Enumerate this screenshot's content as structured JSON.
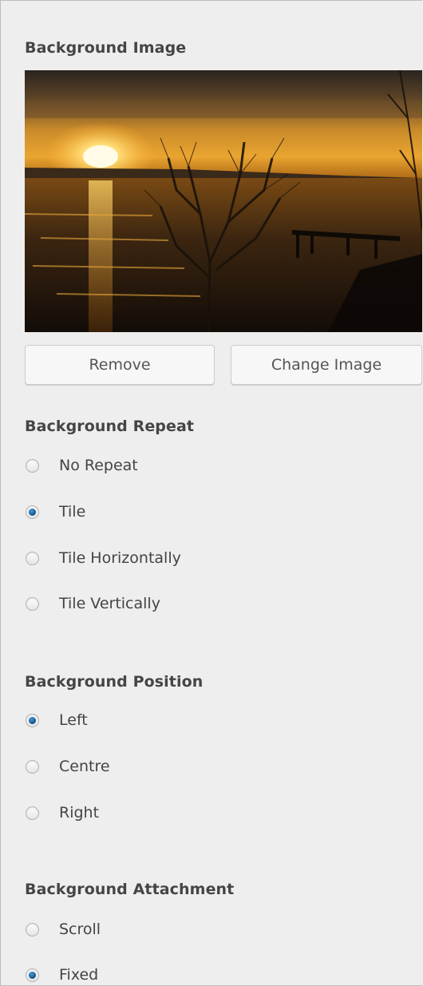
{
  "background_image": {
    "title": "Background Image",
    "remove_label": "Remove",
    "change_label": "Change Image"
  },
  "background_repeat": {
    "title": "Background Repeat",
    "options": [
      {
        "label": "No Repeat",
        "checked": false
      },
      {
        "label": "Tile",
        "checked": true
      },
      {
        "label": "Tile Horizontally",
        "checked": false
      },
      {
        "label": "Tile Vertically",
        "checked": false
      }
    ]
  },
  "background_position": {
    "title": "Background Position",
    "options": [
      {
        "label": "Left",
        "checked": true
      },
      {
        "label": "Centre",
        "checked": false
      },
      {
        "label": "Right",
        "checked": false
      }
    ]
  },
  "background_attachment": {
    "title": "Background Attachment",
    "options": [
      {
        "label": "Scroll",
        "checked": false
      },
      {
        "label": "Fixed",
        "checked": true
      }
    ]
  },
  "colors": {
    "panel_bg": "#eeeeee",
    "radio_checked": "#1a6aa8"
  }
}
